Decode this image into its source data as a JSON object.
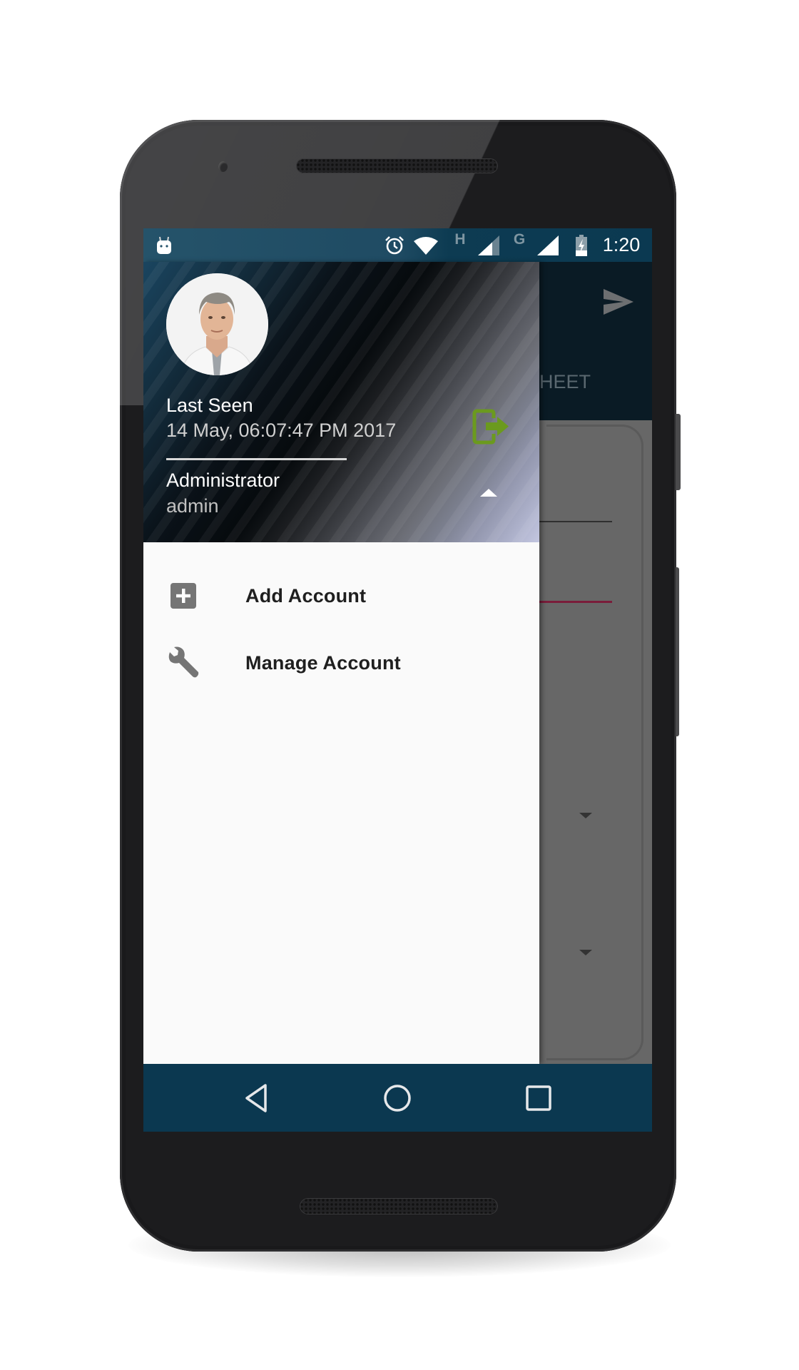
{
  "status_bar": {
    "notification_icon": "android-debug-icon",
    "icons": [
      "alarm-icon",
      "wifi-icon",
      "signal-h-icon",
      "signal-g-icon",
      "battery-charging-icon"
    ],
    "network_h": "H",
    "network_g": "G",
    "time": "1:20"
  },
  "drawer": {
    "header": {
      "avatar_icon": "user-avatar",
      "last_seen_label": "Last Seen",
      "last_seen_value": "14 May, 06:07:47 PM 2017",
      "role": "Administrator",
      "username": "admin",
      "logout_icon": "logout-icon",
      "toggle_icon": "arrow-up-icon"
    },
    "menu": [
      {
        "label": "Add Account",
        "icon": "add-box-icon"
      },
      {
        "label": "Manage Account",
        "icon": "wrench-icon"
      }
    ]
  },
  "background_app": {
    "toolbar_action_icon": "send-icon",
    "tab_label_partial": "HEET",
    "accent_color": "#7a1c3a"
  },
  "nav_bar": {
    "back_icon": "back-icon",
    "home_icon": "home-icon",
    "recents_icon": "recents-icon"
  },
  "colors": {
    "status_bar": "#0b3951",
    "nav_bar": "#0b3850",
    "logout_icon": "#6b9a1e",
    "drawer_bg": "#fafafa",
    "menu_icon": "#757575"
  }
}
